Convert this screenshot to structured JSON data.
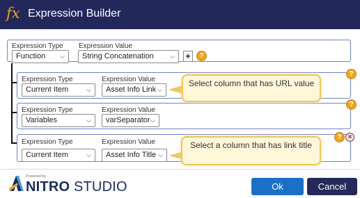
{
  "window": {
    "fx_symbol": "fx",
    "title": "Expression Builder"
  },
  "root": {
    "type_label": "Expression Type",
    "value_label": "Expression Value",
    "type_value": "Function",
    "value_value": "String Concatenation",
    "add_symbol": "+",
    "help_symbol": "?"
  },
  "rows": [
    {
      "type_label": "Expression Type",
      "value_label": "Expression Value",
      "type_value": "Current Item",
      "value_value": "Asset Info Link",
      "help_symbol": "?"
    },
    {
      "type_label": "Expression Type",
      "value_label": "Expression Value",
      "type_value": "Variables",
      "value_value": "varSeparator",
      "help_symbol": "?"
    },
    {
      "type_label": "Expression Type",
      "value_label": "Expression Value",
      "type_value": "Current Item",
      "value_value": "Asset Info Title",
      "help_symbol": "?",
      "close_symbol": "×"
    }
  ],
  "callouts": [
    {
      "text": "Select column that has URL value"
    },
    {
      "text": "Select a column that has link title"
    }
  ],
  "footer": {
    "powered_by": "Powered by",
    "brand_bold": "NITRO",
    "brand_rest": " STUDIO",
    "ok_label": "Ok",
    "cancel_label": "Cancel"
  },
  "colors": {
    "title_bar": "#22285a",
    "accent_orange": "#f0a520",
    "ok_button": "#1b70c6",
    "cancel_button": "#252a5a",
    "group_border": "#6b84c4",
    "callout_border": "#eec660"
  }
}
